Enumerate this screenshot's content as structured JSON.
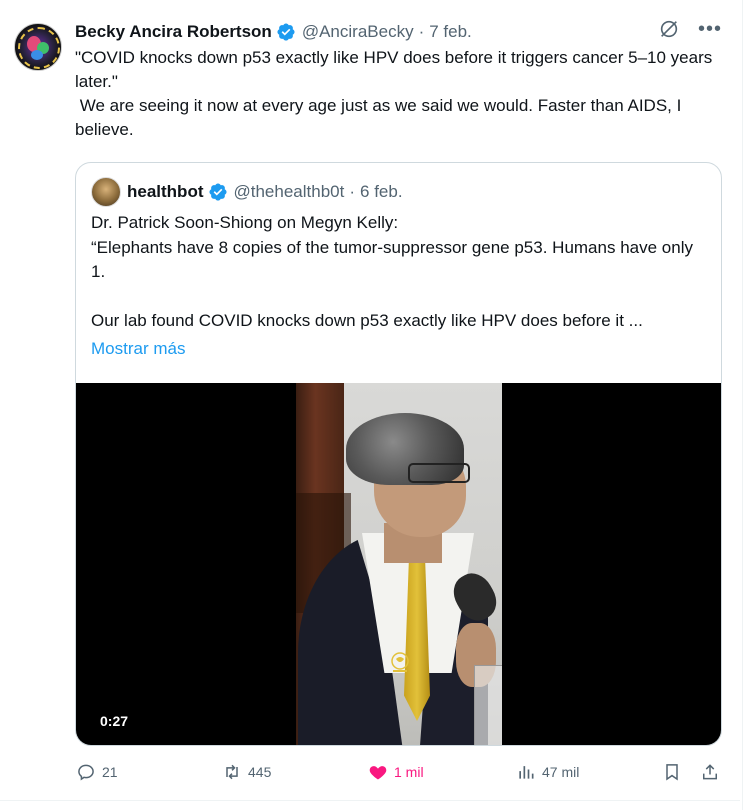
{
  "author": {
    "name": "Becky Ancira Robertson",
    "handle": "@AnciraBecky",
    "date": "7 feb.",
    "separator": "·"
  },
  "tweet_text": "\"COVID knocks down p53 exactly like HPV does before it triggers cancer 5–10 years later.\"\n We are seeing it now at every age just as we said we would. Faster than AIDS, I believe.",
  "quote": {
    "name": "healthbot",
    "handle": "@thehealthb0t",
    "date": "6 feb.",
    "separator": "·",
    "text": "Dr. Patrick Soon-Shiong on Megyn Kelly:\n“Elephants have 8 copies of the tumor-suppressor gene p53. Humans have only 1.\n\nOur lab found COVID knocks down p53 exactly like HPV does before it ...",
    "show_more": "Mostrar más",
    "video_duration": "0:27"
  },
  "actions": {
    "replies": "21",
    "reposts": "445",
    "likes": "1 mil",
    "views": "47 mil"
  },
  "colors": {
    "accent": "#1d9bf0",
    "like": "#f91880",
    "muted": "#536471",
    "verified": "#1d9bf0"
  },
  "icons": {
    "reply": "reply-icon",
    "repost": "repost-icon",
    "like": "heart-icon",
    "views": "views-icon",
    "bookmark": "bookmark-icon",
    "share": "share-icon",
    "grok": "grok-icon",
    "more": "more-icon"
  }
}
